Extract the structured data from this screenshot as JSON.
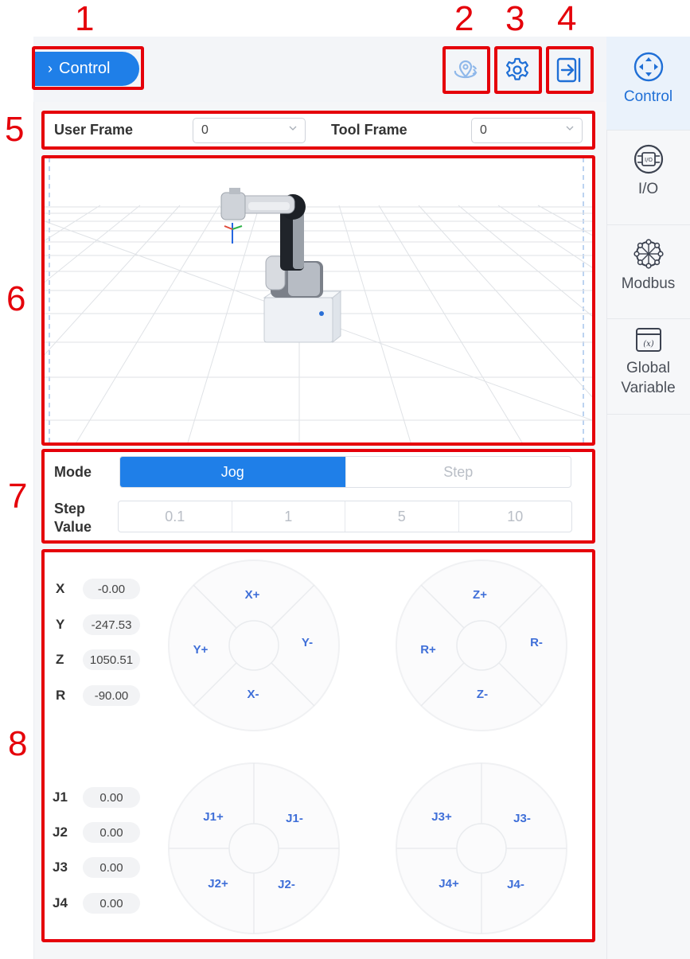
{
  "annotations": [
    "1",
    "2",
    "3",
    "4",
    "5",
    "6",
    "7",
    "8"
  ],
  "header": {
    "control_label": "Control"
  },
  "frames": {
    "user_frame_label": "User Frame",
    "user_frame_value": "0",
    "tool_frame_label": "Tool Frame",
    "tool_frame_value": "0"
  },
  "mode": {
    "label": "Mode",
    "options": [
      "Jog",
      "Step"
    ],
    "selected": "Jog",
    "step_value_label_line1": "Step",
    "step_value_label_line2": "Value",
    "step_values": [
      "0.1",
      "1",
      "5",
      "10"
    ]
  },
  "coordinates": [
    {
      "label": "X",
      "value": "-0.00"
    },
    {
      "label": "Y",
      "value": "-247.53"
    },
    {
      "label": "Z",
      "value": "1050.51"
    },
    {
      "label": "R",
      "value": "-90.00"
    }
  ],
  "joints": [
    {
      "label": "J1",
      "value": "0.00"
    },
    {
      "label": "J2",
      "value": "0.00"
    },
    {
      "label": "J3",
      "value": "0.00"
    },
    {
      "label": "J4",
      "value": "0.00"
    }
  ],
  "wheels": {
    "xy": {
      "top": "X+",
      "left": "Y+",
      "right": "Y-",
      "bottom": "X-"
    },
    "zr": {
      "top": "Z+",
      "left": "R+",
      "right": "R-",
      "bottom": "Z-"
    },
    "j12": {
      "tl": "J1+",
      "tr": "J1-",
      "bl": "J2+",
      "br": "J2-"
    },
    "j34": {
      "tl": "J3+",
      "tr": "J3-",
      "bl": "J4+",
      "br": "J4-"
    }
  },
  "sidebar": {
    "items": [
      {
        "label": "Control",
        "icon": "control-icon"
      },
      {
        "label": "I/O",
        "icon": "io-icon"
      },
      {
        "label": "Modbus",
        "icon": "modbus-icon"
      },
      {
        "label_line1": "Global",
        "label_line2": "Variable",
        "icon": "variable-icon"
      }
    ]
  },
  "colors": {
    "accent": "#1f7fe8",
    "annotation": "#e5000a"
  }
}
